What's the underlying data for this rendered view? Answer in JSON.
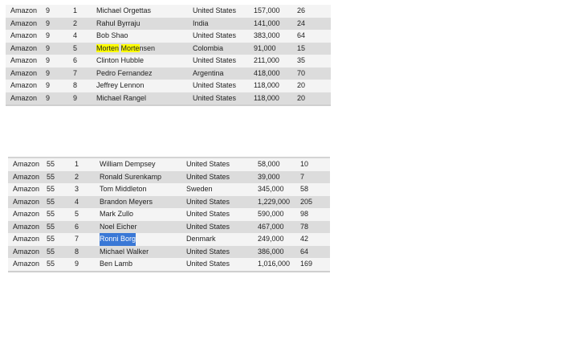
{
  "tables": [
    {
      "rows": [
        [
          "Amazon",
          "9",
          "1",
          "Michael Orgettas",
          "United States",
          "157,000",
          "26"
        ],
        [
          "Amazon",
          "9",
          "2",
          "Rahul Byrraju",
          "India",
          "141,000",
          "24"
        ],
        [
          "Amazon",
          "9",
          "4",
          "Bob Shao",
          "United States",
          "383,000",
          "64"
        ],
        [
          "Amazon",
          "9",
          "5",
          "Morten Mortensen",
          "Colombia",
          "91,000",
          "15"
        ],
        [
          "Amazon",
          "9",
          "6",
          "Clinton Hubble",
          "United States",
          "211,000",
          "35"
        ],
        [
          "Amazon",
          "9",
          "7",
          "Pedro Fernandez",
          "Argentina",
          "418,000",
          "70"
        ],
        [
          "Amazon",
          "9",
          "8",
          "Jeffrey Lennon",
          "United States",
          "118,000",
          "20"
        ],
        [
          "Amazon",
          "9",
          "9",
          "Michael Rangel",
          "United States",
          "118,000",
          "20"
        ]
      ]
    },
    {
      "rows": [
        [
          "Amazon",
          "55",
          "1",
          "William Dempsey",
          "United States",
          "58,000",
          "10"
        ],
        [
          "Amazon",
          "55",
          "2",
          "Ronald Surenkamp",
          "United States",
          "39,000",
          "7"
        ],
        [
          "Amazon",
          "55",
          "3",
          "Tom Middleton",
          "Sweden",
          "345,000",
          "58"
        ],
        [
          "Amazon",
          "55",
          "4",
          "Brandon Meyers",
          "United States",
          "1,229,000",
          "205"
        ],
        [
          "Amazon",
          "55",
          "5",
          "Mark Zullo",
          "United States",
          "590,000",
          "98"
        ],
        [
          "Amazon",
          "55",
          "6",
          "Noel Eicher",
          "United States",
          "467,000",
          "78"
        ],
        [
          "Amazon",
          "55",
          "7",
          "Ronni Borg",
          "Denmark",
          "249,000",
          "42"
        ],
        [
          "Amazon",
          "55",
          "8",
          "Michael Walker",
          "United States",
          "386,000",
          "64"
        ],
        [
          "Amazon",
          "55",
          "9",
          "Ben Lamb",
          "United States",
          "1,016,000",
          "169"
        ]
      ]
    }
  ],
  "highlights": {
    "search_term_color": "#ffff00",
    "selection_color": "#3a78d6"
  }
}
